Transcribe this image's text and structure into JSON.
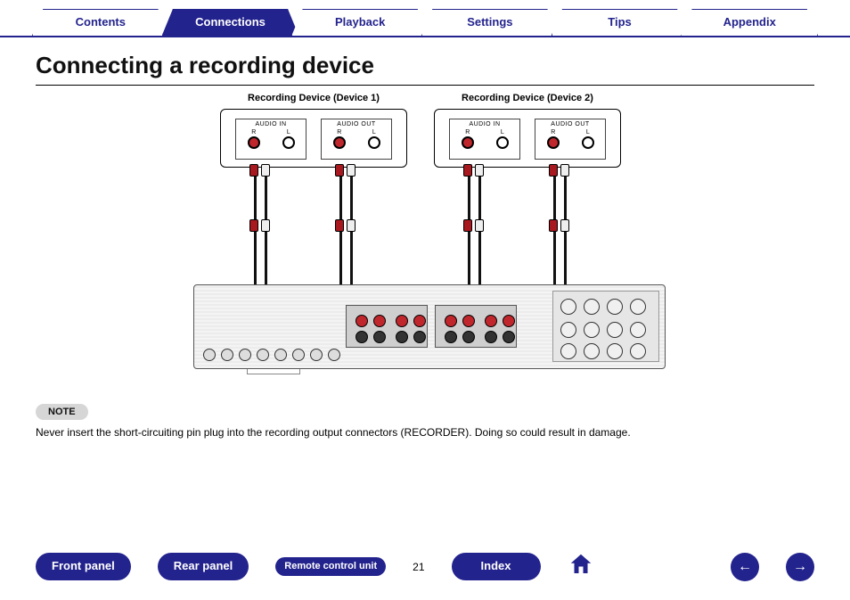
{
  "tabs": {
    "contents": "Contents",
    "connections": "Connections",
    "playback": "Playback",
    "settings": "Settings",
    "tips": "Tips",
    "appendix": "Appendix",
    "active": "connections"
  },
  "title": "Connecting a recording device",
  "diagram": {
    "device1_title": "Recording Device (Device 1)",
    "device2_title": "Recording Device (Device 2)",
    "audio_in": "AUDIO IN",
    "audio_out": "AUDIO OUT",
    "r": "R",
    "l": "L"
  },
  "note": {
    "label": "NOTE",
    "text": "Never insert the short-circuiting pin plug into the recording output connectors (RECORDER). Doing so could result in damage."
  },
  "bottom": {
    "front_panel": "Front panel",
    "rear_panel": "Rear panel",
    "remote": "Remote control unit",
    "index": "Index",
    "page": "21"
  }
}
